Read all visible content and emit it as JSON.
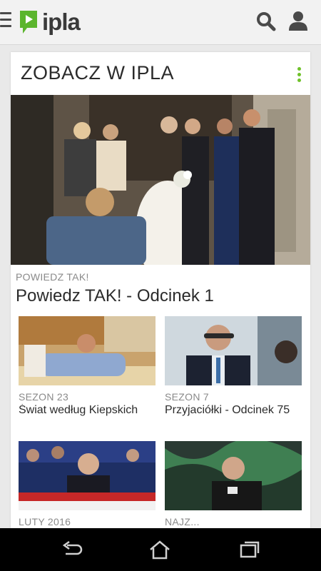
{
  "app": {
    "logo_text": "ipla"
  },
  "section": {
    "title": "ZOBACZ W IPLA"
  },
  "hero": {
    "label": "POWIEDZ TAK!",
    "title": "Powiedz TAK! - Odcinek 1"
  },
  "tiles": [
    {
      "season": "SEZON 23",
      "title": "Świat według Kiepskich"
    },
    {
      "season": "SEZON 7",
      "title": "Przyjaciółki - Odcinek 75"
    },
    {
      "season": "LUTY 2016",
      "title": ""
    },
    {
      "season": "NAJZ...",
      "title": ""
    }
  ],
  "colors": {
    "accent": "#6fc12a",
    "logo_green": "#5bb52d",
    "text_dark": "#2b2b2b",
    "text_muted": "#8a8a8a"
  },
  "icons": [
    "menu-icon",
    "ipla-play-icon",
    "search-icon",
    "user-icon",
    "more-vert-icon",
    "back-icon",
    "home-icon",
    "recents-icon"
  ]
}
